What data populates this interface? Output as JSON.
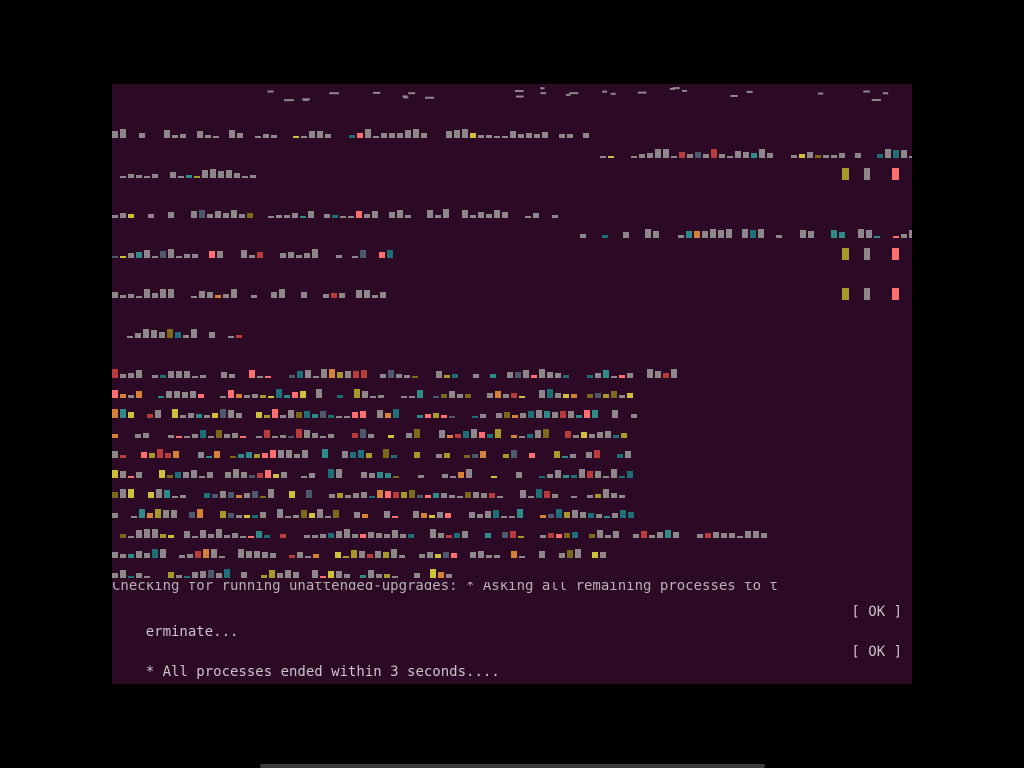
{
  "console": {
    "top_partial": "Checking for running unattended-upgrades: * Asking all remaining processes to t",
    "line_1_text": "erminate...",
    "line_1_status": "[ OK ]",
    "line_2_text": "* All processes ended within 3 seconds....",
    "line_2_status": "[ OK ]"
  },
  "colors": {
    "background": "#2c0a26",
    "text": "#c9c4c6",
    "glitch_palette": [
      "#1f6f78",
      "#2f8a8a",
      "#a89a2a",
      "#cfc23a",
      "#7b6a1c",
      "#ff6f6f",
      "#b83c3c",
      "#d4813a",
      "#4d5a6e"
    ]
  }
}
